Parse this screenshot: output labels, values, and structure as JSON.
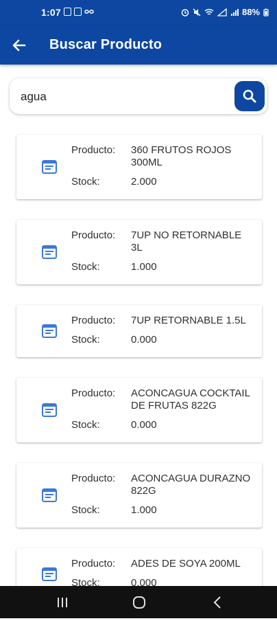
{
  "status_bar": {
    "time": "1:07",
    "battery": "88%"
  },
  "app_bar": {
    "title": "Buscar Producto"
  },
  "search": {
    "value": "agua"
  },
  "colors": {
    "primary": "#0d47a1",
    "icon_blue": "#3b78d8"
  },
  "products": [
    {
      "label_producto": "Producto:",
      "producto": "360 FRUTOS ROJOS 300ML",
      "label_stock": "Stock:",
      "stock": "2.000"
    },
    {
      "label_producto": "Producto:",
      "producto": "7UP NO RETORNABLE 3L",
      "label_stock": "Stock:",
      "stock": "1.000"
    },
    {
      "label_producto": "Producto:",
      "producto": "7UP RETORNABLE 1.5L",
      "label_stock": "Stock:",
      "stock": "0.000"
    },
    {
      "label_producto": "Producto:",
      "producto": "ACONCAGUA COCKTAIL DE FRUTAS 822G",
      "label_stock": "Stock:",
      "stock": "0.000"
    },
    {
      "label_producto": "Producto:",
      "producto": "ACONCAGUA DURAZNO 822G",
      "label_stock": "Stock:",
      "stock": "1.000"
    },
    {
      "label_producto": "Producto:",
      "producto": "ADES DE SOYA 200ML",
      "label_stock": "Stock:",
      "stock": "0.000"
    }
  ],
  "icons": {
    "back": "arrow-back-icon",
    "search": "search-icon",
    "item": "document-list-icon",
    "nav": [
      "recent-apps-icon",
      "home-icon",
      "back-nav-icon"
    ]
  }
}
